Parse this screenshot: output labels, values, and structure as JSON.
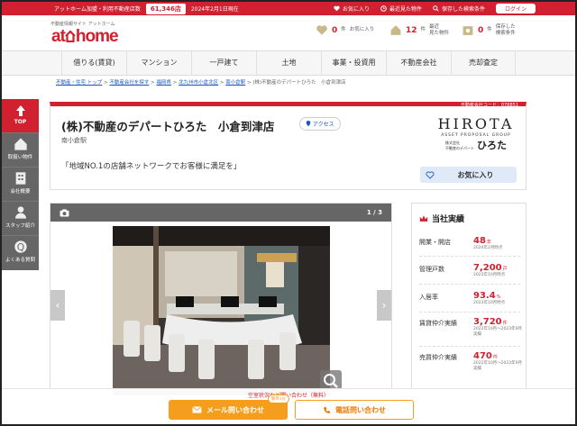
{
  "topbar": {
    "member_text": "アットホーム加盟・利用不動産店数",
    "member_count": "61,346店",
    "as_of": "2024年2月1日現在",
    "favorites": "お気に入り",
    "recent": "最近見た物件",
    "saved_search": "保存した検索条件",
    "login": "ログイン"
  },
  "header": {
    "logo_sub": "不動産情報サイト アットホーム",
    "logo": "at home",
    "fav_count": "0",
    "fav_unit": "件",
    "fav_label": "お気に入り",
    "recent_count": "12",
    "recent_unit": "件",
    "recent_label": "最近\n見た物件",
    "saved_count": "0",
    "saved_unit": "件",
    "saved_label": "保存した\n検索条件"
  },
  "nav": [
    "借りる(賃貸)",
    "マンション",
    "一戸建て",
    "土地",
    "事業・投資用",
    "不動産会社",
    "売却査定"
  ],
  "breadcrumb": {
    "items": [
      "不動産・住宅 トップ",
      "不動産会社を探す",
      "福岡県",
      "北九州市小倉北区",
      "南小倉駅"
    ],
    "current": "(株)不動産のデパートひろた　小倉到津店",
    "sep": ">"
  },
  "sidebar": {
    "top": "TOP",
    "items": [
      "取扱い物件",
      "会社概要",
      "スタッフ紹介",
      "よくある質問"
    ]
  },
  "agency": {
    "id_text": "不動産会社コード：078851",
    "name": "(株)不動産のデパートひろた　小倉到津店",
    "access": "アクセス",
    "station": "南小倉駅",
    "catch": "「地域NO.1の店舗ネットワークでお客様に満足を」",
    "logo_big": "HIROTA",
    "logo_sub": "ASSET PROPOSAL GROUP",
    "logo_small": "株式会社\n不動産のデパート",
    "logo_kana": "ひろた",
    "favorite_button": "お気に入り"
  },
  "gallery": {
    "counter": "1 / 3",
    "camera_icon": "camera-icon",
    "prev": "‹",
    "next": "›"
  },
  "results": {
    "title": "当社実績",
    "rows": [
      {
        "label": "開業・開店",
        "value": "48",
        "unit": "年",
        "note": "2024年2月時点"
      },
      {
        "label": "管理戸数",
        "value": "7,200",
        "unit": "戸",
        "note": "2023年10月時点"
      },
      {
        "label": "入居率",
        "value": "93.4",
        "unit": "%",
        "note": "2023年10月時点"
      },
      {
        "label": "賃貸仲介実績",
        "value": "3,720",
        "unit": "件",
        "note": "2022年10月～2023年9月実績"
      },
      {
        "label": "売買仲介実績",
        "value": "470",
        "unit": "件",
        "note": "2022年10月～2023年9月実績"
      }
    ]
  },
  "cta": {
    "note": "空室状況など問い合わせ（無料）",
    "mail": "メール問い合わせ",
    "mail_badge": "簡単1分",
    "tel": "電話問い合わせ"
  },
  "colors": {
    "brand": "#d1202f",
    "accent": "#f59e1e"
  }
}
